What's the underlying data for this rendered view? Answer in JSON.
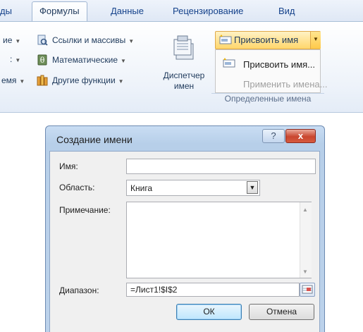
{
  "ribbon": {
    "tabs": [
      {
        "label": "ды"
      },
      {
        "label": "Формулы",
        "active": true
      },
      {
        "label": "Данные"
      },
      {
        "label": "Рецензирование"
      },
      {
        "label": "Вид"
      }
    ],
    "functions": {
      "row1_left": "ие",
      "row2_left": "",
      "row3_left": "емя",
      "links_arrays": "Ссылки и массивы",
      "math": "Математические",
      "other": "Другие функции"
    },
    "dispatcher_label_line1": "Диспетчер",
    "dispatcher_label_line2": "имен",
    "assign_name_button": "Присвоить имя",
    "menu": {
      "assign_name": "Присвоить имя...",
      "apply_names": "Применить имена..."
    },
    "group_label": "Определенные имена"
  },
  "dialog": {
    "title": "Создание имени",
    "help_icon": "?",
    "close_icon": "x",
    "name_label": "Имя:",
    "name_value": "",
    "scope_label": "Область:",
    "scope_value": "Книга",
    "comment_label": "Примечание:",
    "comment_value": "",
    "range_label": "Диапазон:",
    "range_value": "=Лист1!$I$2",
    "ok_label": "ОК",
    "cancel_label": "Отмена"
  },
  "colors": {
    "accent_highlight": "#ffd66b",
    "ribbon_text": "#1e395b",
    "close_red": "#c9462f"
  }
}
